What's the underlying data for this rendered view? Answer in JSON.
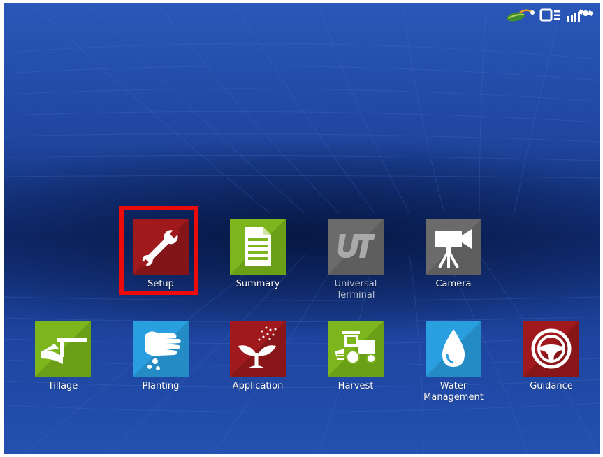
{
  "status_bar": {
    "icons": [
      "leaf-sync-icon",
      "display-connection-icon",
      "satellite-signal-icon"
    ]
  },
  "colors": {
    "background": "#1f469f",
    "red_tile": "#a0191d",
    "green_tile": "#7cb51c",
    "blue_tile": "#2a9fe0",
    "gray_tile": "#6b6b6b",
    "highlight": "#ec0b0b"
  },
  "apps_row1": [
    {
      "label": "Setup",
      "icon": "wrench-icon",
      "color": "red",
      "selected": true
    },
    {
      "label": "Summary",
      "icon": "document-icon",
      "color": "green"
    },
    {
      "label": "Universal\nTerminal",
      "icon": "ut-icon",
      "color": "gray",
      "disabled": true
    },
    {
      "label": "Camera",
      "icon": "camera-icon",
      "color": "gray"
    }
  ],
  "apps_row2": [
    {
      "label": "Tillage",
      "icon": "plow-icon",
      "color": "green"
    },
    {
      "label": "Planting",
      "icon": "hand-seed-icon",
      "color": "blue"
    },
    {
      "label": "Application",
      "icon": "sprout-spray-icon",
      "color": "red"
    },
    {
      "label": "Harvest",
      "icon": "combine-icon",
      "color": "green"
    },
    {
      "label": "Water\nManagement",
      "icon": "water-drop-icon",
      "color": "blue"
    },
    {
      "label": "Guidance",
      "icon": "steering-wheel-icon",
      "color": "red"
    }
  ]
}
